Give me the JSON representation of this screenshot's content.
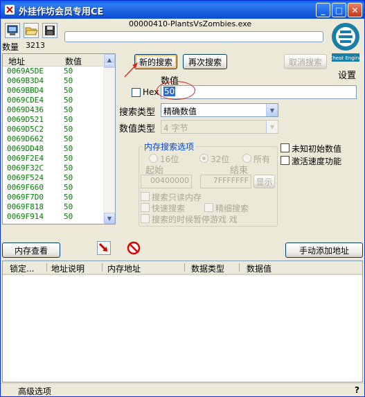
{
  "window": {
    "title": "外挂作坊会员专用CE",
    "process": "00000410-PlantsVsZombies.exe",
    "minimize": "_",
    "maximize": "□",
    "close": "✕"
  },
  "found": {
    "label": "数量",
    "count": "3213"
  },
  "settings_label": "设置",
  "results": {
    "col_address": "地址",
    "col_value": "数值",
    "rows": [
      {
        "address": "0069A5DE",
        "value": "50"
      },
      {
        "address": "0069B3D4",
        "value": "50"
      },
      {
        "address": "0069BBD4",
        "value": "50"
      },
      {
        "address": "0069CDE4",
        "value": "50"
      },
      {
        "address": "0069D436",
        "value": "50"
      },
      {
        "address": "0069D521",
        "value": "50"
      },
      {
        "address": "0069D5C2",
        "value": "50"
      },
      {
        "address": "0069D662",
        "value": "50"
      },
      {
        "address": "0069DD48",
        "value": "50"
      },
      {
        "address": "0069F2E4",
        "value": "50"
      },
      {
        "address": "0069F32C",
        "value": "50"
      },
      {
        "address": "0069F524",
        "value": "50"
      },
      {
        "address": "0069F660",
        "value": "50"
      },
      {
        "address": "0069F7D0",
        "value": "50"
      },
      {
        "address": "0069F818",
        "value": "50"
      },
      {
        "address": "0069F914",
        "value": "50"
      }
    ]
  },
  "scan": {
    "new_scan": "新的搜索",
    "next_scan": "再次搜索",
    "undo_scan": "取消搜索",
    "value_label": "数值",
    "hex_label": "Hex",
    "value": "50",
    "scan_type_label": "搜索类型",
    "scan_type": "精确数值",
    "value_type_label": "数值类型",
    "value_type": "4 字节",
    "unknown_initial": "未知初始数值",
    "speedhack": "激活速度功能"
  },
  "memory_options": {
    "title": "内存搜索选项",
    "bits16": "16位",
    "bits32": "32位",
    "all": "所有",
    "start_label": "起始",
    "stop_label": "结束",
    "start": "00400000",
    "stop": "7FFFFFFF",
    "show": "显示",
    "readonly": "搜索只读内存",
    "fast_scan": "快速搜索",
    "fine_scan": "精细搜索",
    "pause_game": "搜索的时候暂停游戏 戏"
  },
  "bottom": {
    "memory_view": "内存查看",
    "add_address": "手动添加地址"
  },
  "address_list": {
    "col_lock": "锁定...",
    "col_description": "地址说明",
    "col_address": "内存地址",
    "col_type": "数据类型",
    "col_value": "数据值"
  },
  "status": {
    "advanced": "高级选项",
    "help": "?"
  },
  "colors": {
    "title_blue": "#0a5fe8",
    "list_green": "#008000",
    "annotation_red": "#e02020"
  }
}
